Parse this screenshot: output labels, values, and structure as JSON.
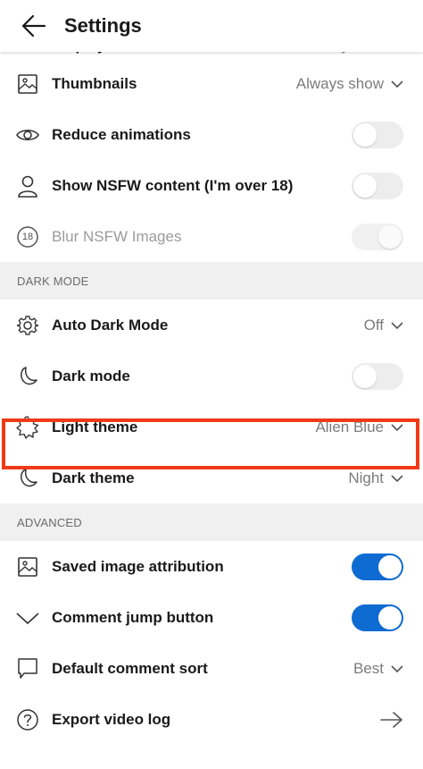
{
  "header": {
    "title": "Settings",
    "back_icon": "arrow-left-icon"
  },
  "partial_row": {
    "label": "Display",
    "value": "Always show"
  },
  "general": [
    {
      "id": "thumbnails",
      "icon": "image-icon",
      "label": "Thumbnails",
      "value": "Always show",
      "control": "dropdown"
    },
    {
      "id": "reduce-animations",
      "icon": "eye-icon",
      "label": "Reduce animations",
      "control": "toggle",
      "on": false
    },
    {
      "id": "show-nsfw",
      "icon": "user-icon",
      "label": "Show NSFW content (I'm over 18)",
      "control": "toggle",
      "on": false
    },
    {
      "id": "blur-nsfw",
      "icon": "nsfw-18-icon",
      "label": "Blur NSFW Images",
      "control": "toggle",
      "on": true,
      "disabled": true,
      "badge": "18"
    }
  ],
  "dark_mode_section": {
    "title": "DARK MODE",
    "items": [
      {
        "id": "auto-dark-mode",
        "icon": "gear-icon",
        "label": "Auto Dark Mode",
        "value": "Off",
        "control": "dropdown"
      },
      {
        "id": "dark-mode",
        "icon": "moon-icon",
        "label": "Dark mode",
        "control": "toggle",
        "on": false
      },
      {
        "id": "light-theme",
        "icon": "sun-icon",
        "label": "Light theme",
        "value": "Alien Blue",
        "control": "dropdown",
        "highlighted": true
      },
      {
        "id": "dark-theme",
        "icon": "moon-icon",
        "label": "Dark theme",
        "value": "Night",
        "control": "dropdown"
      }
    ]
  },
  "advanced_section": {
    "title": "ADVANCED",
    "items": [
      {
        "id": "saved-image-attribution",
        "icon": "image-icon",
        "label": "Saved image attribution",
        "control": "toggle",
        "on": true
      },
      {
        "id": "comment-jump-button",
        "icon": "chevron-down-icon",
        "label": "Comment jump button",
        "control": "toggle",
        "on": true
      },
      {
        "id": "default-comment-sort",
        "icon": "comment-icon",
        "label": "Default comment sort",
        "value": "Best",
        "control": "dropdown"
      },
      {
        "id": "export-video-log",
        "icon": "help-circle-icon",
        "label": "Export video log",
        "control": "arrow"
      }
    ]
  },
  "colors": {
    "accent": "#0d6bd1",
    "highlight": "#f03a17",
    "section_bg": "#f0f0f0"
  }
}
